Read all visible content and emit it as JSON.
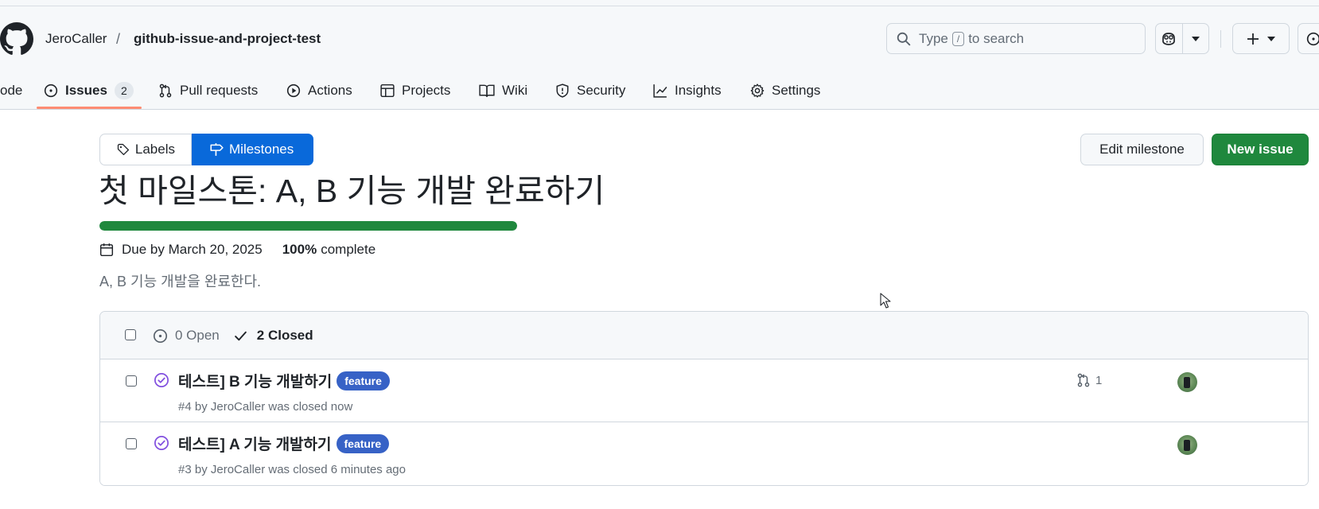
{
  "header": {
    "owner": "JeroCaller",
    "separator": "/",
    "repo": "github-issue-and-project-test",
    "search": {
      "prefix": "Type",
      "key": "/",
      "suffix": "to search"
    }
  },
  "nav": {
    "tabs": [
      {
        "label": "ode"
      },
      {
        "label": "Issues",
        "count": "2",
        "selected": true
      },
      {
        "label": "Pull requests"
      },
      {
        "label": "Actions"
      },
      {
        "label": "Projects"
      },
      {
        "label": "Wiki"
      },
      {
        "label": "Security"
      },
      {
        "label": "Insights"
      },
      {
        "label": "Settings"
      }
    ]
  },
  "subnav": {
    "labels": "Labels",
    "milestones": "Milestones"
  },
  "actions": {
    "edit_milestone": "Edit milestone",
    "new_issue": "New issue"
  },
  "milestone": {
    "title": "첫 마일스톤: A, B 기능 개발 완료하기",
    "progress_fraction": 1.0,
    "due": "Due by March 20, 2025",
    "percent": "100%",
    "percent_label": "complete",
    "description": "A, B 기능 개발을 완료한다."
  },
  "issues_box": {
    "open_label": "0 Open",
    "closed_label": "2 Closed",
    "issues": [
      {
        "title": "테스트] B 기능 개발하기",
        "label": "feature",
        "label_color": "#3762c6",
        "meta": "#4 by JeroCaller was closed now",
        "linked_prs": "1"
      },
      {
        "title": "테스트] A 기능 개발하기",
        "label": "feature",
        "label_color": "#3762c6",
        "meta": "#3 by JeroCaller was closed 6 minutes ago"
      }
    ]
  },
  "colors": {
    "accent": "#0969da",
    "success": "#1f883d",
    "closed_purple": "#8250df",
    "tab_underline": "#fd8c73"
  }
}
